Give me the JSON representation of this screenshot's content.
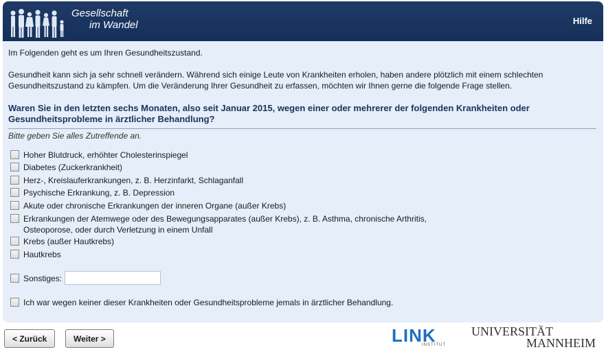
{
  "header": {
    "logo_line1": "Gesellschaft",
    "logo_line2": "im Wandel",
    "help_label": "Hilfe"
  },
  "intro": {
    "paragraph1": "Im Folgenden geht es um Ihren Gesundheitszustand.",
    "paragraph2": "Gesundheit kann sich ja sehr schnell verändern. Während sich einige Leute von Krankheiten erholen, haben andere plötzlich mit einem schlechten Gesundheitszustand zu kämpfen. Um die Veränderung Ihrer Gesundheit zu erfassen, möchten wir Ihnen gerne die folgende Frage stellen."
  },
  "question": {
    "text": "Waren Sie in den letzten sechs Monaten, also seit Januar 2015, wegen einer oder mehrerer der folgenden Krankheiten oder Gesundheitsprobleme in ärztlicher Behandlung?",
    "instruction": "Bitte geben Sie alles Zutreffende an."
  },
  "options": [
    {
      "label": "Hoher Blutdruck, erhöhter Cholesterinspiegel",
      "checked": false
    },
    {
      "label": "Diabetes (Zuckerkrankheit)",
      "checked": false
    },
    {
      "label": "Herz-, Kreislauferkrankungen, z. B. Herzinfarkt, Schlaganfall",
      "checked": false
    },
    {
      "label": "Psychische Erkrankung, z. B. Depression",
      "checked": false
    },
    {
      "label": "Akute oder chronische Erkrankungen der inneren Organe (außer Krebs)",
      "checked": false
    },
    {
      "label": "Erkrankungen der Atemwege oder des Bewegungsapparates (außer Krebs), z. B. Asthma, chronische Arthritis,",
      "label2": "Osteoporose, oder durch Verletzung in einem Unfall",
      "checked": false
    },
    {
      "label": "Krebs (außer Hautkrebs)",
      "checked": false
    },
    {
      "label": "Hautkrebs",
      "checked": false
    }
  ],
  "other": {
    "label": "Sonstiges:",
    "value": "",
    "checked": false
  },
  "none_option": {
    "label": "Ich war wegen keiner dieser Krankheiten oder Gesundheitsprobleme jemals in ärztlicher Behandlung.",
    "checked": false
  },
  "nav": {
    "back_label": "< Zurück",
    "next_label": "Weiter >"
  },
  "footer": {
    "link_logo": "LINK",
    "link_sub": "INSTITUT",
    "uni_line1": "UNIVERSITÄT",
    "uni_line2": "MANNHEIM"
  },
  "colors": {
    "header_bg": "#1f3a66",
    "panel_bg": "#e5eef9",
    "question_text": "#1b3459",
    "link_blue": "#1f6fbf"
  }
}
